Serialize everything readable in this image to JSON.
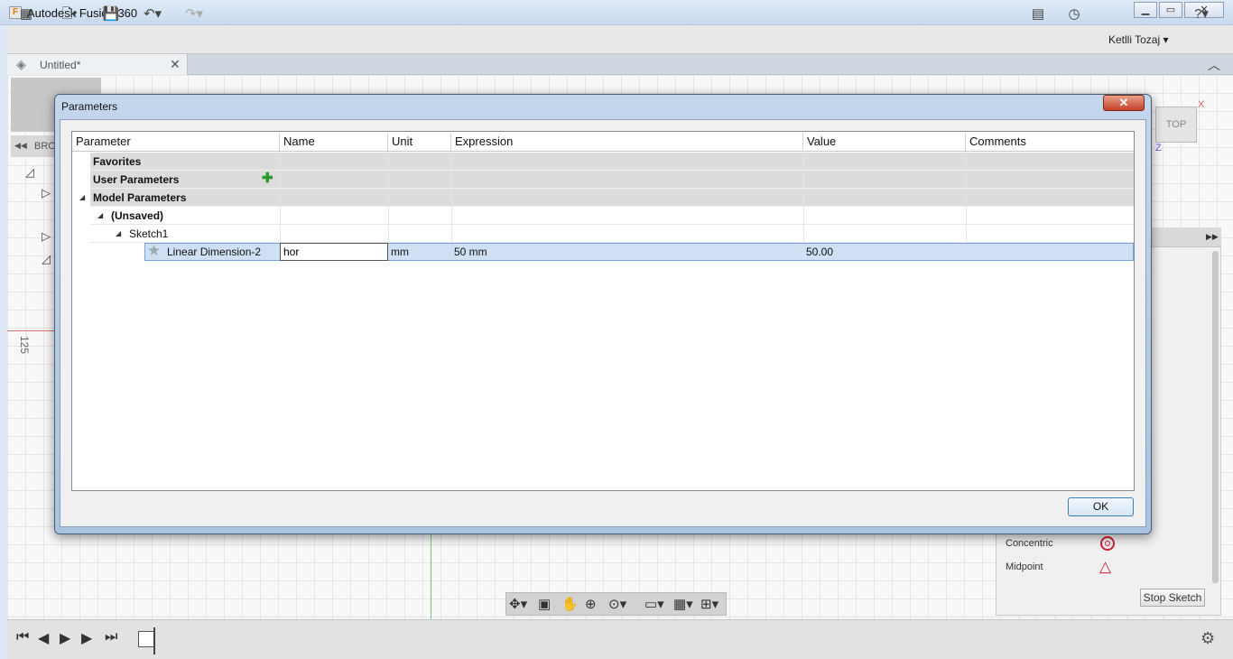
{
  "window": {
    "title": "Autodesk Fusion 360",
    "app_icon": "F"
  },
  "toolbar": {
    "user": "Ketlli Tozaj ▾"
  },
  "tabs": {
    "document": "Untitled*"
  },
  "browser": {
    "label": "BRO"
  },
  "canvas": {
    "ruler_value": "125"
  },
  "viewcube": {
    "face": "TOP",
    "axis_x": "X",
    "axis_z": "Z"
  },
  "palette": {
    "items": [
      {
        "label": "Concentric",
        "icon": "concentric-icon"
      },
      {
        "label": "Midpoint",
        "icon": "midpoint-icon"
      }
    ],
    "stop_label": "Stop Sketch"
  },
  "dialog": {
    "title": "Parameters",
    "columns": [
      "Parameter",
      "Name",
      "Unit",
      "Expression",
      "Value",
      "Comments"
    ],
    "groups": {
      "favorites": "Favorites",
      "user": "User Parameters",
      "model": "Model Parameters",
      "unsaved": "(Unsaved)",
      "sketch": "Sketch1"
    },
    "row": {
      "parameter": "Linear Dimension-2",
      "name": "hor",
      "unit": "mm",
      "expression": "50 mm",
      "value": "50.00",
      "comments": ""
    },
    "ok_label": "OK"
  },
  "colors": {
    "accent": "#3c7fb1",
    "selection": "#cfe0f5",
    "close": "#c5412a"
  }
}
